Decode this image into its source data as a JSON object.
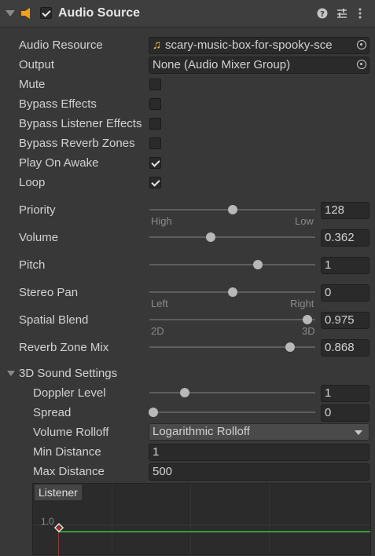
{
  "component": {
    "title": "Audio Source",
    "enabled": true,
    "header_icons": [
      "help-icon",
      "presets-icon",
      "more-menu-icon"
    ]
  },
  "properties": {
    "audio_resource": {
      "label": "Audio Resource",
      "value": "scary-music-box-for-spooky-sce"
    },
    "output": {
      "label": "Output",
      "value": "None (Audio Mixer Group)"
    },
    "mute": {
      "label": "Mute",
      "checked": false
    },
    "bypass_effects": {
      "label": "Bypass Effects",
      "checked": false
    },
    "bypass_listener_effects": {
      "label": "Bypass Listener Effects",
      "checked": false
    },
    "bypass_reverb_zones": {
      "label": "Bypass Reverb Zones",
      "checked": false
    },
    "play_on_awake": {
      "label": "Play On Awake",
      "checked": true
    },
    "loop": {
      "label": "Loop",
      "checked": true
    },
    "priority": {
      "label": "Priority",
      "value": "128",
      "level": 0.5,
      "min_label": "High",
      "max_label": "Low"
    },
    "volume": {
      "label": "Volume",
      "value": "0.362",
      "level": 0.362
    },
    "pitch": {
      "label": "Pitch",
      "value": "1",
      "level": 0.66
    },
    "stereo_pan": {
      "label": "Stereo Pan",
      "value": "0",
      "level": 0.5,
      "min_label": "Left",
      "max_label": "Right"
    },
    "spatial_blend": {
      "label": "Spatial Blend",
      "value": "0.975",
      "level": 0.975,
      "min_label": "2D",
      "max_label": "3D"
    },
    "reverb_zone_mix": {
      "label": "Reverb Zone Mix",
      "value": "0.868",
      "level": 0.868
    }
  },
  "sound_3d": {
    "title": "3D Sound Settings",
    "doppler_level": {
      "label": "Doppler Level",
      "value": "1",
      "level": 0.2
    },
    "spread": {
      "label": "Spread",
      "value": "0",
      "level": 0
    },
    "volume_rolloff": {
      "label": "Volume Rolloff",
      "value": "Logarithmic Rolloff"
    },
    "min_distance": {
      "label": "Min Distance",
      "value": "1"
    },
    "max_distance": {
      "label": "Max Distance",
      "value": "500"
    }
  },
  "graph": {
    "listener_label": "Listener",
    "y_tick": "1.0"
  },
  "colors": {
    "background": "#383838",
    "field": "#2a2a2a",
    "text": "#d2d2d2",
    "speaker_icon": "#f0a020",
    "resource_icon": "#f2c94c",
    "listener_line": "#d01e1e",
    "curve_line": "#3c9a3c"
  }
}
